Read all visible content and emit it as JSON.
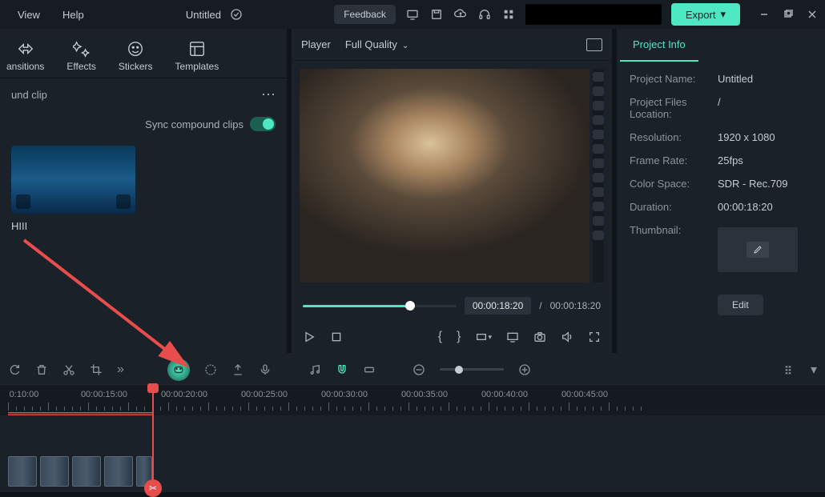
{
  "menu": {
    "view": "View",
    "help": "Help"
  },
  "title": "Untitled",
  "topbar": {
    "feedback": "Feedback",
    "export": "Export"
  },
  "tabs": {
    "transitions": "ansitions",
    "effects": "Effects",
    "stickers": "Stickers",
    "templates": "Templates"
  },
  "clip_header": "und clip",
  "sync_label": "Sync compound clips",
  "clip_name": "HIII",
  "player": {
    "label": "Player",
    "quality": "Full Quality",
    "current_time": "00:00:18:20",
    "total_time": "00:00:18:20",
    "separator": "/"
  },
  "project_info": {
    "tab": "Project Info",
    "name_label": "Project Name:",
    "name_value": "Untitled",
    "location_label": "Project Files Location:",
    "location_value": "/",
    "resolution_label": "Resolution:",
    "resolution_value": "1920 x 1080",
    "framerate_label": "Frame Rate:",
    "framerate_value": "25fps",
    "colorspace_label": "Color Space:",
    "colorspace_value": "SDR - Rec.709",
    "duration_label": "Duration:",
    "duration_value": "00:00:18:20",
    "thumbnail_label": "Thumbnail:",
    "edit_btn": "Edit"
  },
  "timeline": {
    "marks": [
      "0:10:00",
      "00:00:15:00",
      "00:00:20:00",
      "00:00:25:00",
      "00:00:30:00",
      "00:00:35:00",
      "00:00:40:00",
      "00:00:45:00"
    ]
  }
}
